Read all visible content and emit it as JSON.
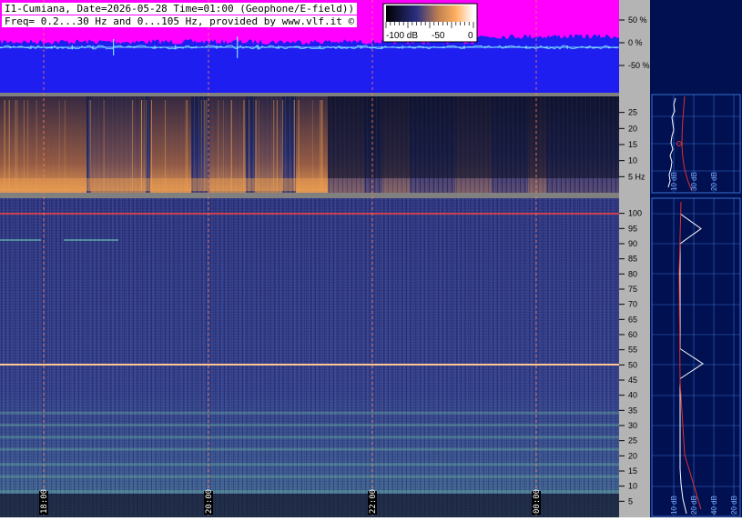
{
  "header": {
    "line1": "I1-Cumiana, Date=2026-05-28 Time=01:00 (Geophone/E-field))",
    "line2": "Freq= 0.2...30 Hz and 0...105 Hz, provided by www.vlf.it ©"
  },
  "colorbar": {
    "labels": [
      "-100 dB",
      "-50",
      "0"
    ]
  },
  "waveform_axis": {
    "ticks": [
      "50 %",
      "0 %",
      "-50 %"
    ]
  },
  "colors": {
    "waveform_bg": "#1e1ef0",
    "waveform_top": "#ff00ff",
    "waveform_trace": "#7fe0ff",
    "spectrogram_bg": "#2a2f78",
    "panel_bg": "#001050",
    "axis_bg": "#b4b4b4",
    "marker_line": "#ff6040"
  },
  "chart_data": [
    {
      "type": "line",
      "title": "",
      "xlabel": "",
      "ylabel": "",
      "ylim": [
        -100,
        100
      ],
      "yticks": [
        "50 %",
        "0 %",
        "-50 %"
      ],
      "series": [
        {
          "values": [
            2,
            3,
            2,
            4,
            3,
            15,
            2,
            3,
            4,
            2,
            3,
            20,
            4,
            3,
            2,
            3,
            2,
            3,
            2,
            3,
            2,
            2,
            3,
            2,
            2,
            3,
            2,
            3,
            2,
            2
          ]
        }
      ]
    },
    {
      "type": "heatmap",
      "title": "",
      "ylabel": "Hz",
      "ylim": [
        0,
        30
      ],
      "yticks": [
        5,
        10,
        15,
        20,
        25
      ],
      "ytick_labels": [
        "5 Hz",
        "10",
        "15",
        "20",
        "25"
      ],
      "xticks": [
        "18:00",
        "20:00",
        "22:00",
        "00:00"
      ],
      "colorbar_range_db": [
        -100,
        0
      ]
    },
    {
      "type": "heatmap",
      "title": "",
      "ylabel": "Hz",
      "ylim": [
        0,
        105
      ],
      "yticks": [
        5,
        10,
        15,
        20,
        25,
        30,
        35,
        40,
        45,
        50,
        55,
        60,
        65,
        70,
        75,
        80,
        85,
        90,
        95,
        100
      ],
      "xticks": [
        "18:00",
        "20:00",
        "22:00",
        "00:00"
      ],
      "strong_lines_hz": [
        50,
        100
      ],
      "colorbar_range_db": [
        -100,
        0
      ]
    },
    {
      "type": "line",
      "title": "",
      "xlabel": "dB",
      "xticks": [
        "10 dB",
        "30 dB",
        "20 dB"
      ],
      "ylim": [
        0,
        30
      ],
      "series": [
        {
          "values": [
            4,
            6,
            5,
            7,
            8,
            6,
            9,
            7,
            8,
            10,
            9,
            8,
            11,
            10,
            12
          ]
        }
      ]
    },
    {
      "type": "line",
      "title": "",
      "xlabel": "dB",
      "xticks": [
        "10 dB",
        "20 dB",
        "40 dB",
        "20 dB"
      ],
      "ylim": [
        0,
        105
      ],
      "series": [
        {
          "values": [
            12,
            8,
            6,
            5,
            5,
            5,
            5,
            5,
            5,
            5,
            30,
            5,
            5,
            5,
            5,
            5,
            5,
            5,
            5,
            28,
            5
          ]
        }
      ]
    }
  ]
}
